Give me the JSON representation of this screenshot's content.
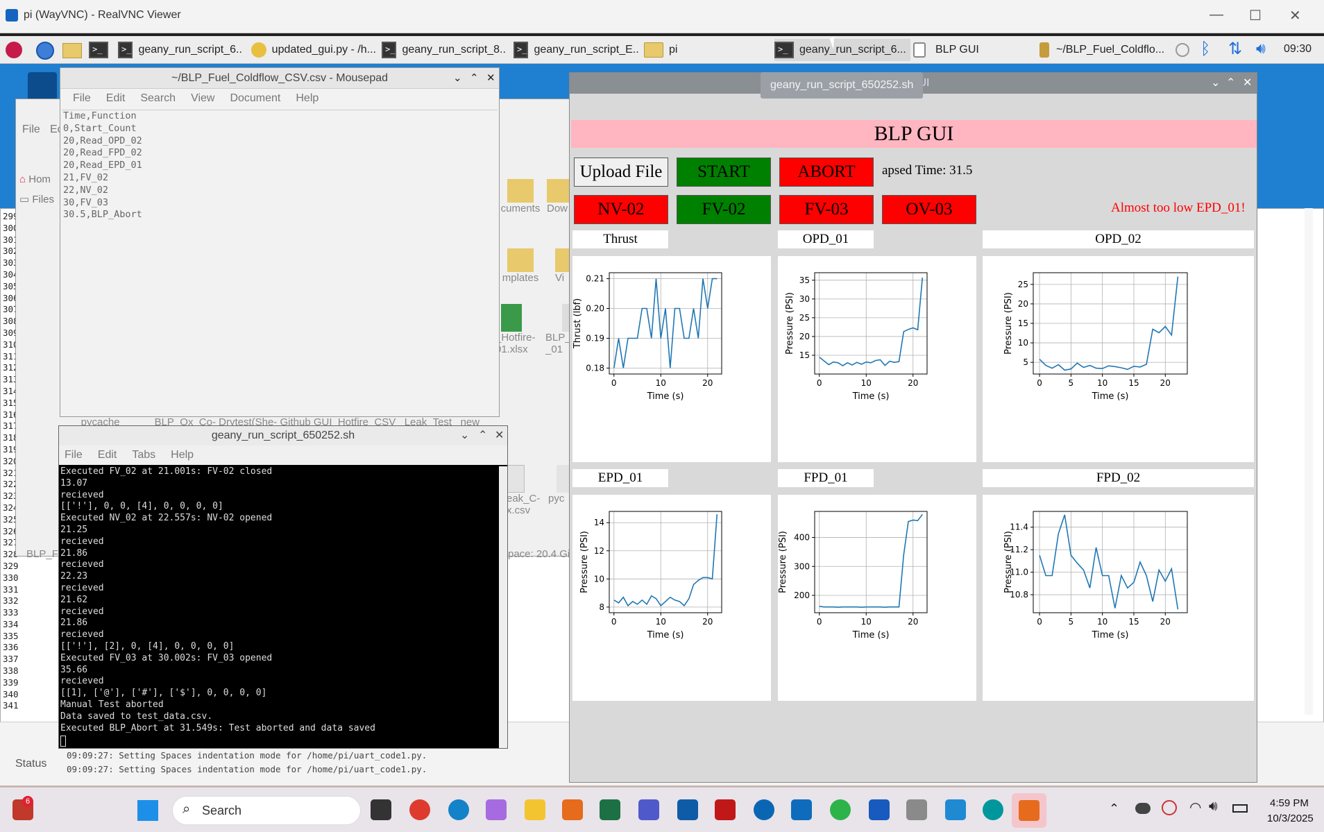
{
  "vnc": {
    "title": "pi (WayVNC) - RealVNC Viewer",
    "min": "—",
    "max": "☐",
    "close": "✕"
  },
  "panel": {
    "tasks": [
      "geany_run_script_6...",
      "updated_gui.py - /h...",
      "geany_run_script_8...",
      "geany_run_script_E...",
      "pi",
      "geany_run_script_6...",
      "BLP GUI",
      "~/BLP_Fuel_Coldflo..."
    ],
    "clock": "09:30",
    "tooltip": "geany_run_script_650252.sh"
  },
  "mousepad": {
    "title": "~/BLP_Fuel_Coldflow_CSV.csv - Mousepad",
    "menu": [
      "File",
      "Edit",
      "Search",
      "View",
      "Document",
      "Help"
    ],
    "lines": [
      "Time,Function",
      "0,Start_Count",
      "20,Read_OPD_02",
      "20,Read_FPD_02",
      "20,Read_EPD_01",
      "21,FV_02",
      "22,NV_02",
      "30,FV_03",
      "30.5,BLP_Abort"
    ]
  },
  "filemgr": {
    "menu": [
      "File",
      "Ec"
    ],
    "sidebar": [
      "Hom",
      "Files"
    ],
    "items": [
      "cuments",
      "Dow",
      "mplates",
      "Vi",
      "_Hotfire-\n01.xlsx",
      "BLP_\n_01",
      "eak_C-\nx.csv",
      "pyc"
    ],
    "folders": "__pycache__        BLP_Ox_Co- Drytest(She- Github GUI  Hotfire_CSV   Leak_Test   new_",
    "status": "pace: 20.4 Gi",
    "blpf": "BLP_F"
  },
  "geany": {
    "line_numbers": [
      "299",
      "300",
      "301",
      "302",
      "303",
      "304",
      "305",
      "306",
      "307",
      "308",
      "309",
      "310",
      "311",
      "312",
      "313",
      "314",
      "315",
      "316",
      "317",
      "318",
      "319",
      "320",
      "321",
      "322",
      "323",
      "324",
      "325",
      "326",
      "327",
      "328",
      "329",
      "330",
      "331",
      "332",
      "333",
      "334",
      "335",
      "336",
      "337",
      "338",
      "339",
      "340",
      "341"
    ],
    "status_tab": "Status",
    "messages": [
      "09:09:27: Setting Spaces indentation mode for /home/pi/uart_code1.py.",
      "09:09:27: Setting Spaces indentation mode for /home/pi/uart_code1.py."
    ]
  },
  "terminal": {
    "title": "geany_run_script_650252.sh",
    "menu": [
      "File",
      "Edit",
      "Tabs",
      "Help"
    ],
    "lines": [
      "Executed FV_02 at 21.001s: FV-02 closed",
      "13.07",
      "recieved",
      "[['!'], 0, 0, [4], 0, 0, 0, 0]",
      "Executed NV_02 at 22.557s: NV-02 opened",
      "21.25",
      "recieved",
      "21.86",
      "recieved",
      "22.23",
      "recieved",
      "21.62",
      "recieved",
      "21.86",
      "recieved",
      "[['!'], [2], 0, [4], 0, 0, 0, 0]",
      "Executed FV_03 at 30.002s: FV_03 opened",
      "35.66",
      "recieved",
      "[[1], ['@'], ['#'], ['$'], 0, 0, 0, 0]",
      "Manual Test aborted",
      "Data saved to test_data.csv.",
      "Executed BLP_Abort at 31.549s: Test aborted and data saved"
    ]
  },
  "gui": {
    "title": "GUI",
    "banner": "BLP GUI",
    "upload": "Upload File",
    "start": "START",
    "abort": "ABORT",
    "elapsed": "apsed Time: 31.5",
    "nv02": "NV-02",
    "fv02": "FV-02",
    "fv03": "FV-03",
    "ov03": "OV-03",
    "warning": "Almost too low EPD_01!",
    "labels": [
      "Thrust",
      "OPD_01",
      "OPD_02",
      "EPD_01",
      "FPD_01",
      "FPD_02"
    ],
    "colors": {
      "green": "#008000",
      "red": "#ff0000",
      "banner": "#ffb6c1",
      "line": "#1f77b4",
      "warning": "#ff0000"
    }
  },
  "taskbar": {
    "search": "Search",
    "time": "4:59 PM",
    "date": "10/3/2025",
    "badge": "6"
  },
  "chart_data": [
    {
      "type": "line",
      "title": "Thrust",
      "xlabel": "Time (s)",
      "ylabel": "Thrust (lbf)",
      "xlim": [
        -1,
        23
      ],
      "ylim": [
        0.178,
        0.212
      ],
      "xticks": [
        0,
        10,
        20
      ],
      "yticks": [
        0.18,
        0.19,
        0.2,
        0.21
      ],
      "x": [
        0,
        1,
        2,
        3,
        4,
        5,
        6,
        7,
        8,
        9,
        10,
        11,
        12,
        13,
        14,
        15,
        16,
        17,
        18,
        19,
        20,
        21,
        22
      ],
      "y": [
        0.18,
        0.19,
        0.18,
        0.19,
        0.19,
        0.19,
        0.2,
        0.2,
        0.19,
        0.21,
        0.19,
        0.2,
        0.18,
        0.2,
        0.2,
        0.19,
        0.19,
        0.2,
        0.19,
        0.21,
        0.2,
        0.21,
        0.21
      ]
    },
    {
      "type": "line",
      "title": "OPD_01",
      "xlabel": "Time (s)",
      "ylabel": "Pressure (PSI)",
      "xlim": [
        -1,
        23
      ],
      "ylim": [
        10,
        37
      ],
      "xticks": [
        0,
        10,
        20
      ],
      "yticks": [
        15,
        20,
        25,
        30,
        35
      ],
      "x": [
        0,
        1,
        2,
        3,
        4,
        5,
        6,
        7,
        8,
        9,
        10,
        11,
        12,
        13,
        14,
        15,
        16,
        17,
        18,
        19,
        20,
        21,
        22
      ],
      "y": [
        14.5,
        13.5,
        12.5,
        13.2,
        13.0,
        12.2,
        13.0,
        12.4,
        13.1,
        12.6,
        13.2,
        13.0,
        13.6,
        13.8,
        12.3,
        13.4,
        13.1,
        13.3,
        21.3,
        21.9,
        22.3,
        21.8,
        35.7
      ]
    },
    {
      "type": "line",
      "title": "OPD_02",
      "xlabel": "Time (s)",
      "ylabel": "Pressure (PSI)",
      "xlim": [
        -1,
        23.5
      ],
      "ylim": [
        2,
        28
      ],
      "xticks": [
        0,
        5,
        10,
        15,
        20
      ],
      "yticks": [
        5,
        10,
        15,
        20,
        25
      ],
      "x": [
        0,
        1,
        2,
        3,
        4,
        5,
        6,
        7,
        8,
        9,
        10,
        11,
        12,
        13,
        14,
        15,
        16,
        17,
        18,
        19,
        20,
        21,
        22
      ],
      "y": [
        5.8,
        4.2,
        3.5,
        4.4,
        3.0,
        3.3,
        4.8,
        3.7,
        4.2,
        3.5,
        3.4,
        4.1,
        3.9,
        3.6,
        3.2,
        4.0,
        3.8,
        4.5,
        13.5,
        12.6,
        14.2,
        12.0,
        27.0
      ]
    },
    {
      "type": "line",
      "title": "EPD_01",
      "xlabel": "Time (s)",
      "ylabel": "Pressure (PSI)",
      "xlim": [
        -1,
        23
      ],
      "ylim": [
        7.6,
        14.8
      ],
      "xticks": [
        0,
        10,
        20
      ],
      "yticks": [
        8,
        10,
        12,
        14
      ],
      "x": [
        0,
        1,
        2,
        3,
        4,
        5,
        6,
        7,
        8,
        9,
        10,
        11,
        12,
        13,
        14,
        15,
        16,
        17,
        18,
        19,
        20,
        21,
        22
      ],
      "y": [
        8.5,
        8.3,
        8.7,
        8.1,
        8.4,
        8.2,
        8.5,
        8.2,
        8.8,
        8.6,
        8.1,
        8.4,
        8.7,
        8.5,
        8.4,
        8.1,
        8.6,
        9.6,
        9.9,
        10.1,
        10.1,
        10.0,
        14.6
      ]
    },
    {
      "type": "line",
      "title": "FPD_01",
      "xlabel": "Time (s)",
      "ylabel": "Pressure (PSI)",
      "xlim": [
        -1,
        23
      ],
      "ylim": [
        140,
        490
      ],
      "xticks": [
        0,
        10,
        20
      ],
      "yticks": [
        200,
        300,
        400
      ],
      "x": [
        0,
        1,
        2,
        3,
        4,
        5,
        6,
        7,
        8,
        9,
        10,
        11,
        12,
        13,
        14,
        15,
        16,
        17,
        18,
        19,
        20,
        21,
        22
      ],
      "y": [
        162,
        160,
        160,
        160,
        159,
        160,
        160,
        160,
        160,
        159,
        160,
        160,
        160,
        160,
        159,
        160,
        160,
        160,
        340,
        455,
        460,
        458,
        480
      ]
    },
    {
      "type": "line",
      "title": "FPD_02",
      "xlabel": "Time (s)",
      "ylabel": "Pressure (PSI)",
      "xlim": [
        -1,
        23.5
      ],
      "ylim": [
        10.64,
        11.54
      ],
      "xticks": [
        0,
        5,
        10,
        15,
        20
      ],
      "yticks": [
        10.8,
        11.0,
        11.2,
        11.4
      ],
      "x": [
        0,
        1,
        2,
        3,
        4,
        5,
        6,
        7,
        8,
        9,
        10,
        11,
        12,
        13,
        14,
        15,
        16,
        17,
        18,
        19,
        20,
        21,
        22
      ],
      "y": [
        11.15,
        10.97,
        10.97,
        11.34,
        11.51,
        11.15,
        11.08,
        11.02,
        10.86,
        11.22,
        10.97,
        10.97,
        10.68,
        10.97,
        10.86,
        10.91,
        11.09,
        10.97,
        10.74,
        11.02,
        10.92,
        11.03,
        10.67
      ]
    }
  ]
}
